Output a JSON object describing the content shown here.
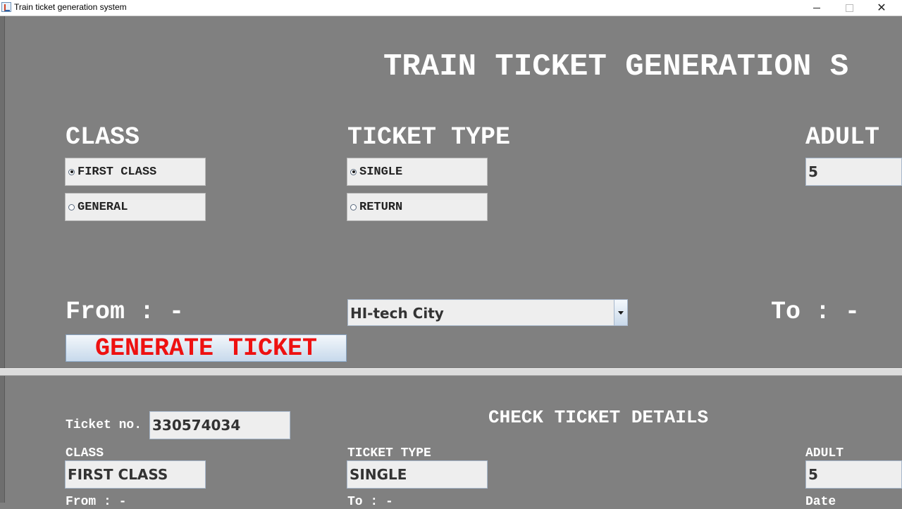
{
  "window": {
    "title": "Train ticket generation system",
    "minimize_symbol": "",
    "maximize_symbol": "",
    "close_symbol": "✕"
  },
  "colors": {
    "background": "#808080",
    "text": "#ffffff",
    "accent_red": "#ee1111"
  },
  "header": {
    "title": "TRAIN TICKET GENERATION S"
  },
  "booking": {
    "class_heading": "CLASS",
    "class_options": [
      {
        "label": "FIRST CLASS",
        "selected": true
      },
      {
        "label": "GENERAL",
        "selected": false
      }
    ],
    "ticket_type_heading": "TICKET TYPE",
    "ticket_type_options": [
      {
        "label": "SINGLE",
        "selected": true
      },
      {
        "label": "RETURN",
        "selected": false
      }
    ],
    "adult_heading": "ADULT",
    "adult_value": "5",
    "from_label": "From : -",
    "from_selected": "HI-tech City",
    "to_label": "To : -",
    "generate_button": "GENERATE TICKET"
  },
  "details": {
    "heading": "CHECK TICKET DETAILS",
    "ticket_no_label": "Ticket no.",
    "ticket_no_value": "330574034",
    "class_label": "CLASS",
    "class_value": "FIRST CLASS",
    "ticket_type_label": "TICKET TYPE",
    "ticket_type_value": "SINGLE",
    "adult_label": "ADULT",
    "adult_value": "5",
    "from_label": "From : -",
    "to_label": "To : -",
    "date_label": "Date"
  }
}
